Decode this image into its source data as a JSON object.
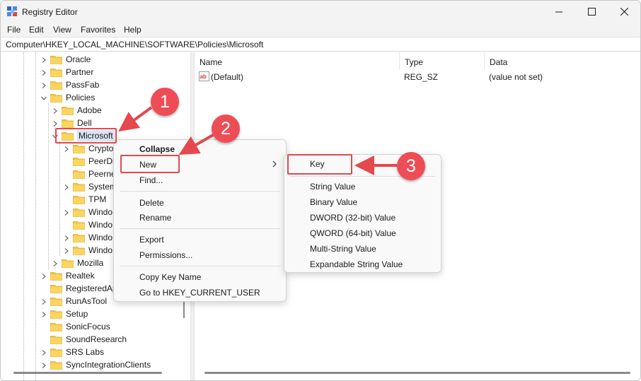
{
  "window": {
    "title": "Registry Editor"
  },
  "menu": [
    "File",
    "Edit",
    "View",
    "Favorites",
    "Help"
  ],
  "address": "Computer\\HKEY_LOCAL_MACHINE\\SOFTWARE\\Policies\\Microsoft",
  "tree": [
    {
      "label": "Oracle",
      "chevron": "right"
    },
    {
      "label": "Partner",
      "chevron": "right"
    },
    {
      "label": "PassFab",
      "chevron": "right"
    },
    {
      "label": "Policies",
      "chevron": "down"
    },
    {
      "label": "Adobe",
      "chevron": "right"
    },
    {
      "label": "Dell",
      "chevron": "right"
    },
    {
      "label": "Microsoft",
      "chevron": "down",
      "selected": true
    },
    {
      "label": "Crypto",
      "chevron": "right"
    },
    {
      "label": "PeerDi",
      "chevron": ""
    },
    {
      "label": "Peerne",
      "chevron": ""
    },
    {
      "label": "System",
      "chevron": "right"
    },
    {
      "label": "TPM",
      "chevron": ""
    },
    {
      "label": "Windo",
      "chevron": "right"
    },
    {
      "label": "Windo",
      "chevron": ""
    },
    {
      "label": "Windo",
      "chevron": "right"
    },
    {
      "label": "Windo",
      "chevron": "right"
    },
    {
      "label": "Mozilla",
      "chevron": "right"
    },
    {
      "label": "Realtek",
      "chevron": "right"
    },
    {
      "label": "RegisteredAp",
      "chevron": ""
    },
    {
      "label": "RunAsTool",
      "chevron": "right"
    },
    {
      "label": "Setup",
      "chevron": "right"
    },
    {
      "label": "SonicFocus",
      "chevron": ""
    },
    {
      "label": "SoundResearch",
      "chevron": ""
    },
    {
      "label": "SRS Labs",
      "chevron": "right"
    },
    {
      "label": "SyncIntegrationClients",
      "chevron": "right"
    }
  ],
  "columns": {
    "name": "Name",
    "type": "Type",
    "data": "Data"
  },
  "values": [
    {
      "name": "(Default)",
      "type": "REG_SZ",
      "data": "(value not set)"
    }
  ],
  "context_menu": {
    "collapse": "Collapse",
    "new": "New",
    "find": "Find...",
    "delete": "Delete",
    "rename": "Rename",
    "export": "Export",
    "permissions": "Permissions...",
    "copy_key_name": "Copy Key Name",
    "goto": "Go to HKEY_CURRENT_USER"
  },
  "submenu": {
    "key": "Key",
    "string": "String Value",
    "binary": "Binary Value",
    "dword": "DWORD (32-bit) Value",
    "qword": "QWORD (64-bit) Value",
    "multi": "Multi-String Value",
    "expandable": "Expandable String Value"
  },
  "annotations": {
    "step1": "1",
    "step2": "2",
    "step3": "3"
  },
  "colors": {
    "annotation_red": "#e5484d",
    "folder": "#f5c646",
    "selection": "#d9e5f3"
  }
}
